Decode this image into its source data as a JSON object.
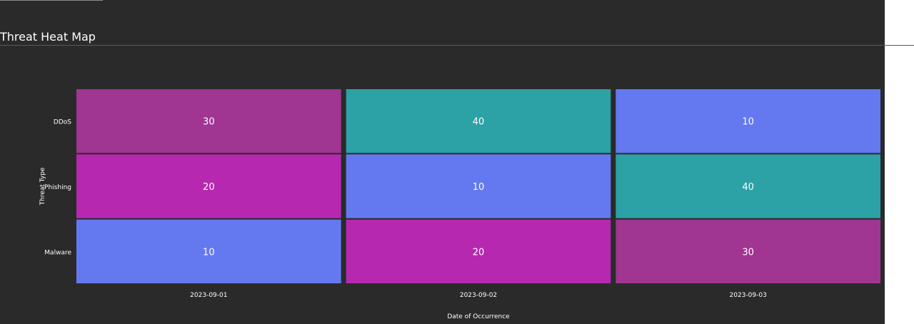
{
  "header": {
    "title": "Threat Heat Map"
  },
  "colors": {
    "background": "#2a2a2a",
    "value_10": "#6479f0",
    "value_20": "#b628b0",
    "value_30": "#a03592",
    "value_40": "#2ca1a6",
    "cell_text": "#ffffff"
  },
  "chart_data": {
    "type": "heatmap",
    "title": "Threat Heat Map",
    "xlabel": "Date of Occurrence",
    "ylabel": "Threat Type",
    "x_categories": [
      "2023-09-01",
      "2023-09-02",
      "2023-09-03"
    ],
    "y_categories": [
      "DDoS",
      "Phishing",
      "Malware"
    ],
    "values": [
      [
        30,
        40,
        10
      ],
      [
        20,
        10,
        40
      ],
      [
        10,
        20,
        30
      ]
    ],
    "show_values": true,
    "legend": "none"
  }
}
